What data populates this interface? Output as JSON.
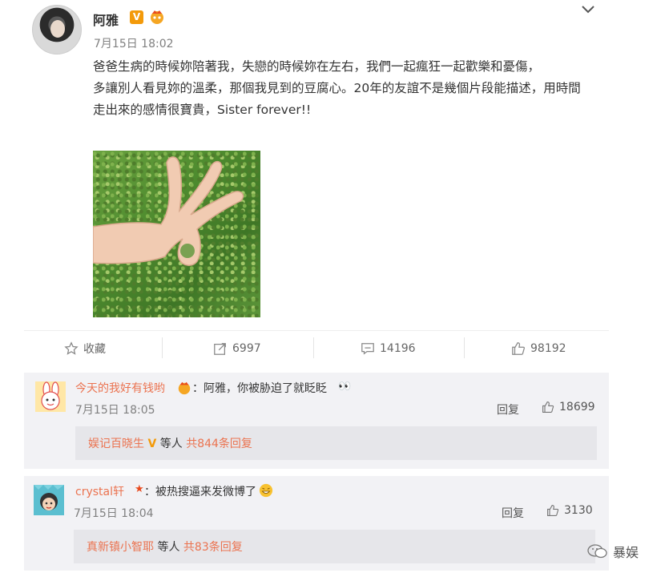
{
  "post": {
    "author": "阿雅",
    "time": "7月15日 18:02",
    "text_lines": [
      "爸爸生病的時候妳陪著我，失戀的時候妳在左右，我們一起瘋狂一起歡樂和憂傷，",
      "多讓別人看見妳的溫柔，那個我見到的豆腐心。20年的友誼不是幾個片段能描述，用時間走出來的感情很寶貴，Sister forever!!"
    ]
  },
  "actions": {
    "favorite_label": "收藏",
    "repost_count": "6997",
    "comment_count": "14196",
    "like_count": "98192"
  },
  "comments": [
    {
      "author": "今天的我好有钱哟",
      "text": "：阿雅，你被胁迫了就眨眨",
      "time": "7月15日 18:05",
      "reply_label": "回复",
      "likes": "18699",
      "sub_author": "娱记百晓生",
      "sub_mid": "等人",
      "sub_count": "共844条回复"
    },
    {
      "author": "crystal轩",
      "text": "：被热搜逼来发微博了",
      "time": "7月15日 18:04",
      "reply_label": "回复",
      "likes": "3130",
      "sub_author": "真新镇小智耶",
      "sub_mid": "等人",
      "sub_count": "共83条回复"
    }
  ],
  "watermark": "暴娱",
  "colors": {
    "accent": "#eb7350",
    "verified": "#f39a0a",
    "comment_bg": "#f2f2f5"
  }
}
